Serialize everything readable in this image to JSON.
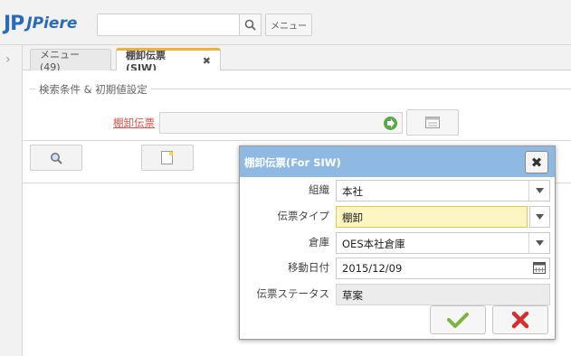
{
  "app": {
    "logo_jp": "JP",
    "logo_name": "JPiere",
    "menu_button": "メニュー"
  },
  "tabs": [
    {
      "label": "メニュー (49)"
    },
    {
      "label": "棚卸伝票(SIW)",
      "close": "✖"
    }
  ],
  "search_panel": {
    "legend": "検索条件 & 初期値設定",
    "doc_label": "棚卸伝票"
  },
  "dialog": {
    "title": "棚卸伝票(For SIW)",
    "fields": [
      {
        "label": "組織",
        "value": "本社"
      },
      {
        "label": "伝票タイプ",
        "value": "棚卸"
      },
      {
        "label": "倉庫",
        "value": "OES本社倉庫"
      },
      {
        "label": "移動日付",
        "value": "2015/12/09"
      },
      {
        "label": "伝票ステータス",
        "value": "草案"
      }
    ]
  },
  "colors": {
    "accent": "#8fb9e3",
    "tab_active": "#f0b03a",
    "highlight": "#fdf6c3",
    "ok": "#7cb342",
    "cancel": "#d32f2f"
  },
  "icons": [
    "search-icon",
    "chevron-right-icon",
    "go-arrow-icon",
    "calendar-icon",
    "new-record-icon",
    "close-icon",
    "checkmark-icon",
    "cancel-x-icon",
    "dropdown-arrow-icon"
  ]
}
